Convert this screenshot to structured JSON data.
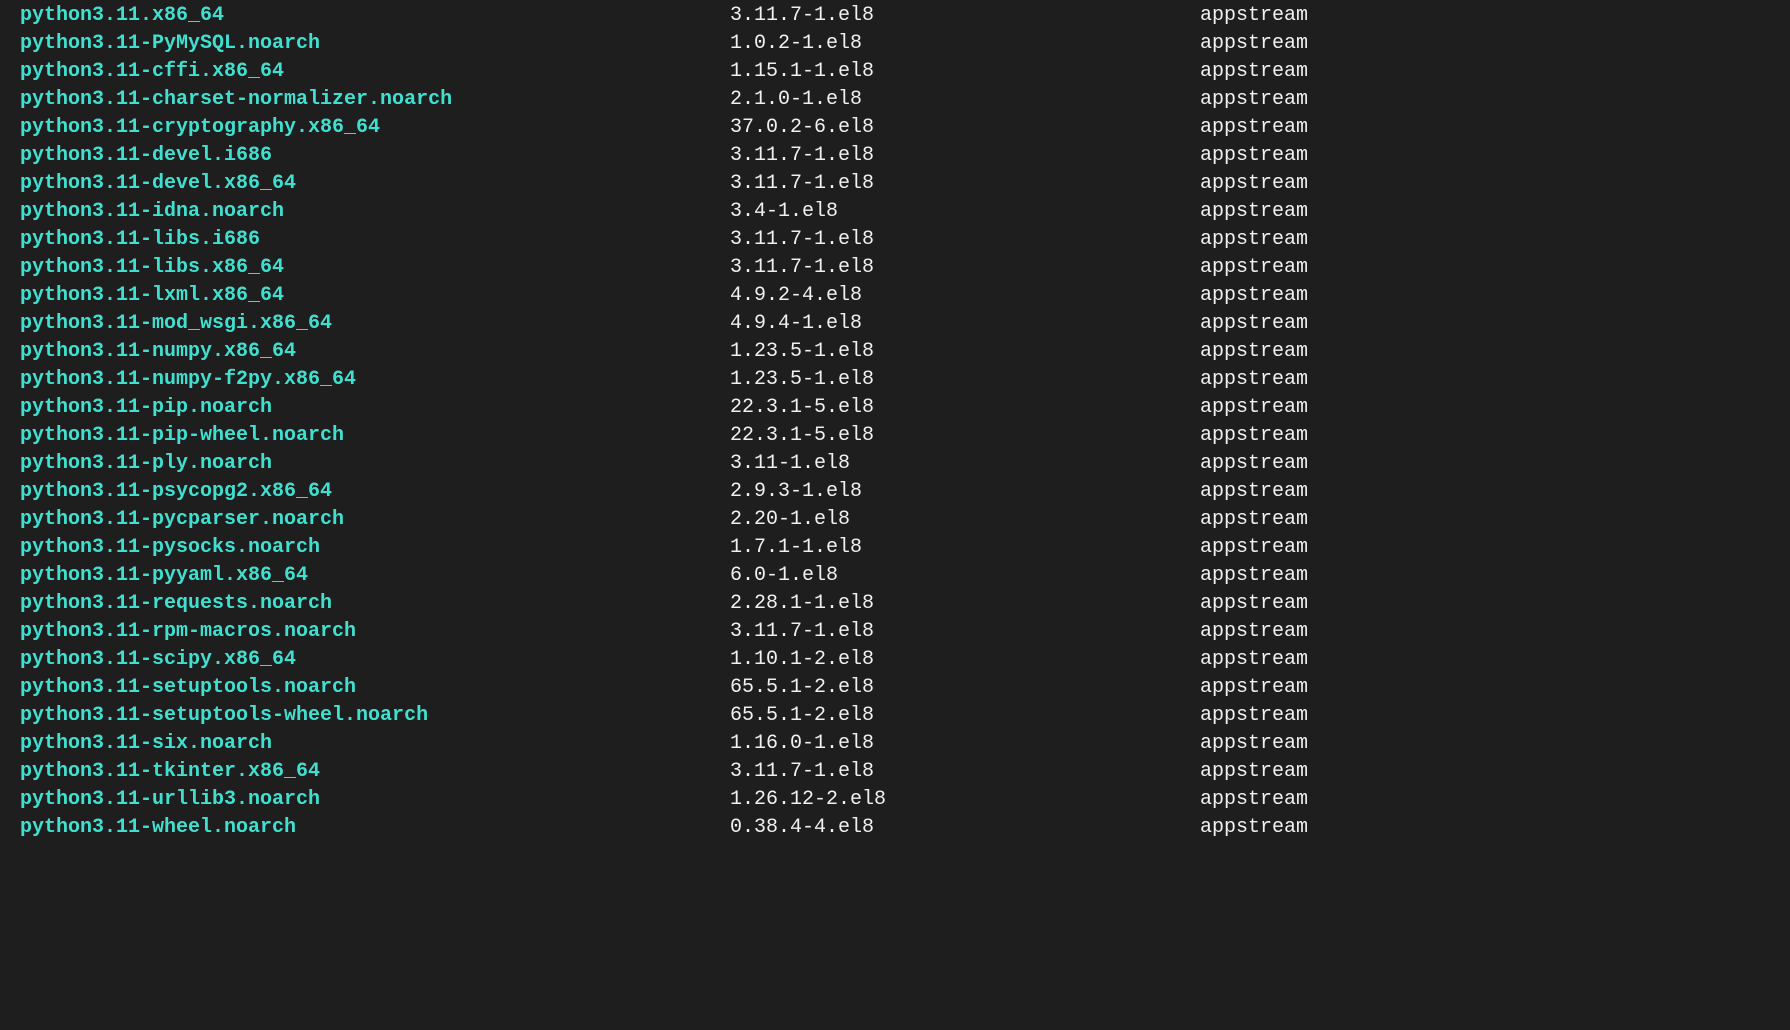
{
  "packages": [
    {
      "name": "python3.11.x86_64",
      "version": "3.11.7-1.el8",
      "repo": "appstream"
    },
    {
      "name": "python3.11-PyMySQL.noarch",
      "version": "1.0.2-1.el8",
      "repo": "appstream"
    },
    {
      "name": "python3.11-cffi.x86_64",
      "version": "1.15.1-1.el8",
      "repo": "appstream"
    },
    {
      "name": "python3.11-charset-normalizer.noarch",
      "version": "2.1.0-1.el8",
      "repo": "appstream"
    },
    {
      "name": "python3.11-cryptography.x86_64",
      "version": "37.0.2-6.el8",
      "repo": "appstream"
    },
    {
      "name": "python3.11-devel.i686",
      "version": "3.11.7-1.el8",
      "repo": "appstream"
    },
    {
      "name": "python3.11-devel.x86_64",
      "version": "3.11.7-1.el8",
      "repo": "appstream"
    },
    {
      "name": "python3.11-idna.noarch",
      "version": "3.4-1.el8",
      "repo": "appstream"
    },
    {
      "name": "python3.11-libs.i686",
      "version": "3.11.7-1.el8",
      "repo": "appstream"
    },
    {
      "name": "python3.11-libs.x86_64",
      "version": "3.11.7-1.el8",
      "repo": "appstream"
    },
    {
      "name": "python3.11-lxml.x86_64",
      "version": "4.9.2-4.el8",
      "repo": "appstream"
    },
    {
      "name": "python3.11-mod_wsgi.x86_64",
      "version": "4.9.4-1.el8",
      "repo": "appstream"
    },
    {
      "name": "python3.11-numpy.x86_64",
      "version": "1.23.5-1.el8",
      "repo": "appstream"
    },
    {
      "name": "python3.11-numpy-f2py.x86_64",
      "version": "1.23.5-1.el8",
      "repo": "appstream"
    },
    {
      "name": "python3.11-pip.noarch",
      "version": "22.3.1-5.el8",
      "repo": "appstream"
    },
    {
      "name": "python3.11-pip-wheel.noarch",
      "version": "22.3.1-5.el8",
      "repo": "appstream"
    },
    {
      "name": "python3.11-ply.noarch",
      "version": "3.11-1.el8",
      "repo": "appstream"
    },
    {
      "name": "python3.11-psycopg2.x86_64",
      "version": "2.9.3-1.el8",
      "repo": "appstream"
    },
    {
      "name": "python3.11-pycparser.noarch",
      "version": "2.20-1.el8",
      "repo": "appstream"
    },
    {
      "name": "python3.11-pysocks.noarch",
      "version": "1.7.1-1.el8",
      "repo": "appstream"
    },
    {
      "name": "python3.11-pyyaml.x86_64",
      "version": "6.0-1.el8",
      "repo": "appstream"
    },
    {
      "name": "python3.11-requests.noarch",
      "version": "2.28.1-1.el8",
      "repo": "appstream"
    },
    {
      "name": "python3.11-rpm-macros.noarch",
      "version": "3.11.7-1.el8",
      "repo": "appstream"
    },
    {
      "name": "python3.11-scipy.x86_64",
      "version": "1.10.1-2.el8",
      "repo": "appstream"
    },
    {
      "name": "python3.11-setuptools.noarch",
      "version": "65.5.1-2.el8",
      "repo": "appstream"
    },
    {
      "name": "python3.11-setuptools-wheel.noarch",
      "version": "65.5.1-2.el8",
      "repo": "appstream"
    },
    {
      "name": "python3.11-six.noarch",
      "version": "1.16.0-1.el8",
      "repo": "appstream"
    },
    {
      "name": "python3.11-tkinter.x86_64",
      "version": "3.11.7-1.el8",
      "repo": "appstream"
    },
    {
      "name": "python3.11-urllib3.noarch",
      "version": "1.26.12-2.el8",
      "repo": "appstream"
    },
    {
      "name": "python3.11-wheel.noarch",
      "version": "0.38.4-4.el8",
      "repo": "appstream"
    }
  ]
}
